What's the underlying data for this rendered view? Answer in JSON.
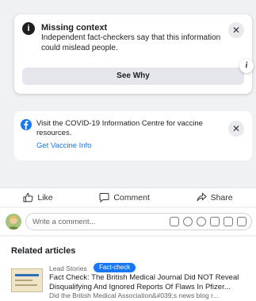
{
  "context_card": {
    "title": "Missing context",
    "description": "Independent fact-checkers say that this information could mislead people.",
    "see_why_label": "See Why",
    "close_glyph": "✕",
    "info_glyph": "i",
    "side_info_glyph": "i"
  },
  "covid_card": {
    "text": "Visit the COVID-19 Information Centre for vaccine resources.",
    "link": "Get Vaccine Info",
    "close_glyph": "✕"
  },
  "actions": {
    "like": "Like",
    "comment": "Comment",
    "share": "Share"
  },
  "comment_box": {
    "placeholder": "Write a comment..."
  },
  "related": {
    "heading": "Related articles",
    "article": {
      "source": "Lead Stories",
      "badge": "Fact-check",
      "title": "Fact Check: The British Medical Journal Did NOT Reveal Disqualifying And Ignored Reports Of Flaws In Pfizer...",
      "snippet": "Did the British Medical Association&#039;s news blog r..."
    }
  },
  "colors": {
    "accent": "#1877f2",
    "background": "#f0f1f3"
  }
}
